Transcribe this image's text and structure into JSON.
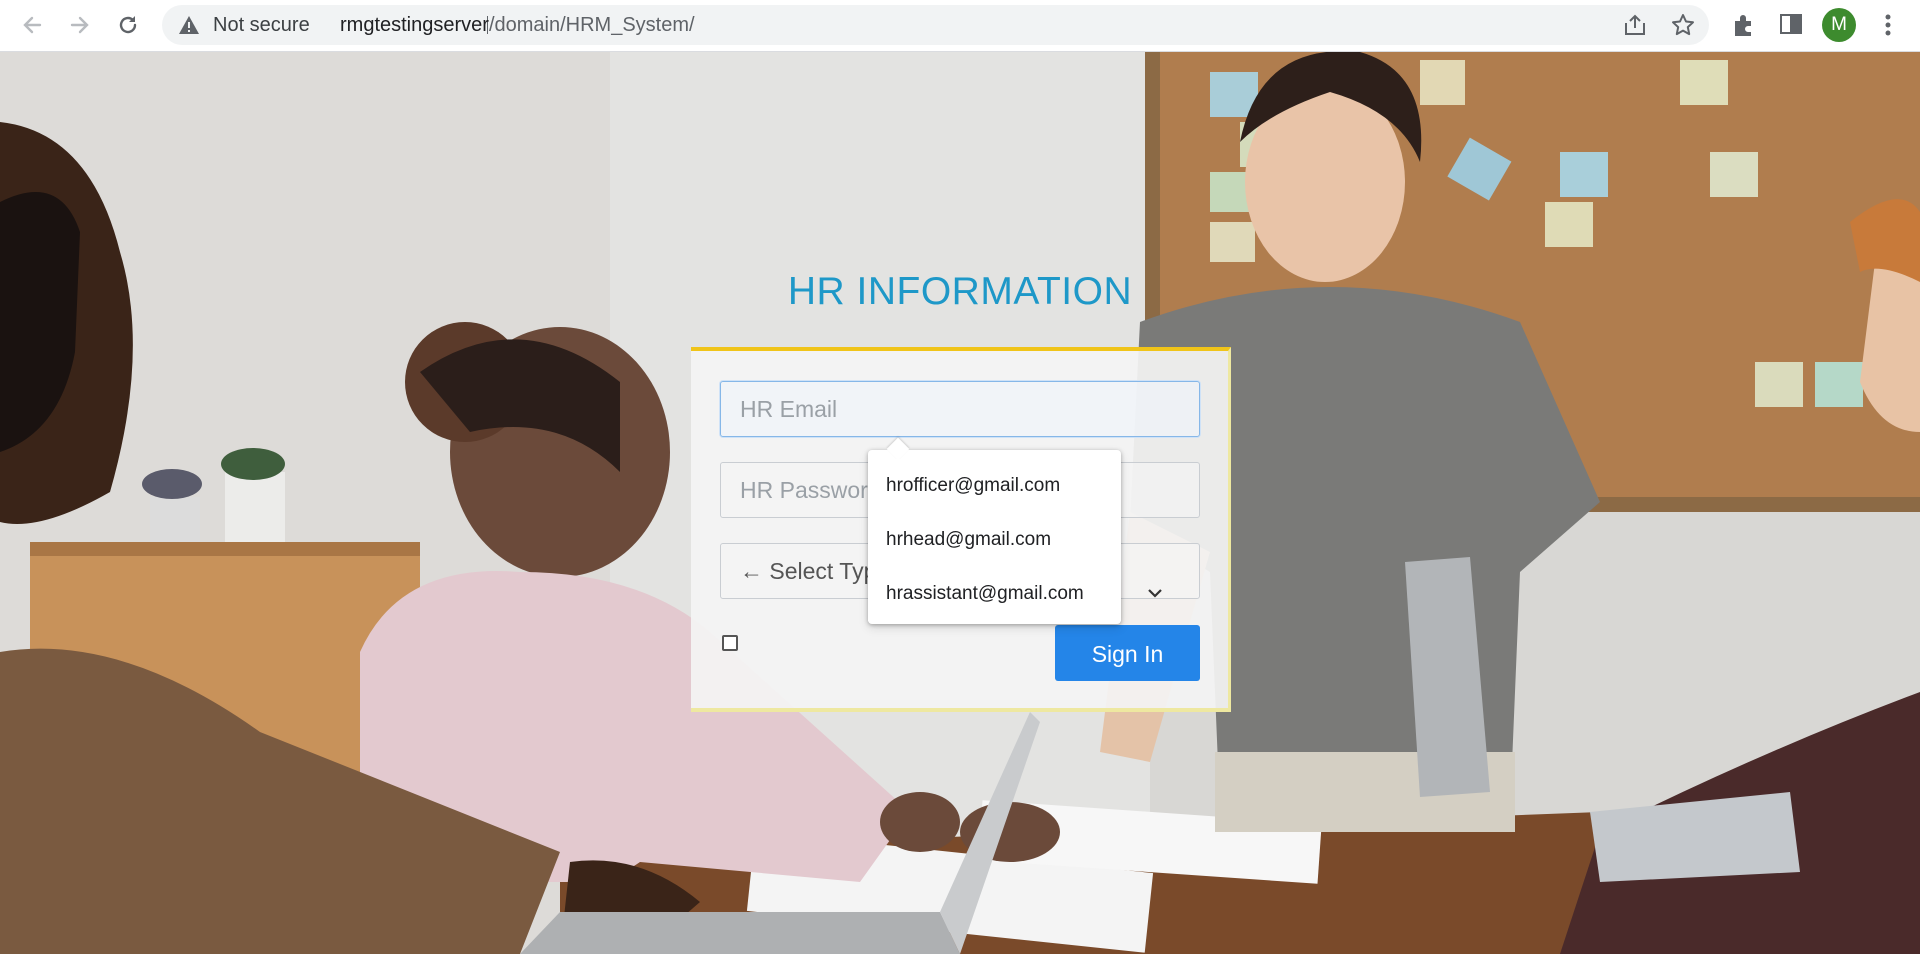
{
  "browser": {
    "security_label": "Not secure",
    "url_host": "rmgtestingserver",
    "url_path": "/domain/HRM_System/",
    "profile_initial": "M",
    "icons": [
      "back-icon",
      "forward-icon",
      "reload-icon",
      "warning-icon",
      "share-icon",
      "star-icon",
      "extensions-icon",
      "side-panel-icon",
      "menu-icon"
    ]
  },
  "login": {
    "title": "HR INFORMATION",
    "email_placeholder": "HR Email",
    "password_placeholder": "HR Password",
    "select_visible_text": "← Select Typ",
    "signin_label": "Sign In"
  },
  "autocomplete": {
    "items": [
      "hrofficer@gmail.com",
      "hrhead@gmail.com",
      "hrassistant@gmail.com"
    ]
  },
  "colors": {
    "title": "#1e98c8",
    "signin_button": "#2485e8",
    "box_top_border": "#f0c419",
    "avatar": "#3d8b2e"
  }
}
